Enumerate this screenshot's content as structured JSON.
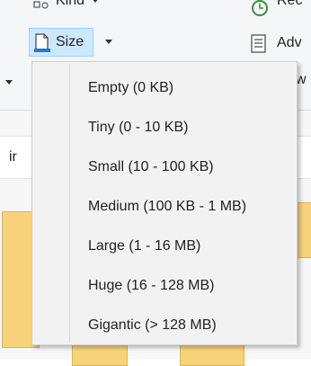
{
  "ribbon": {
    "kind_label": "Kind",
    "size_label": "Size",
    "recent_fragment": "Rec",
    "advanced_fragment": "Adv",
    "w_fragment": "w"
  },
  "header": {
    "fragment": "ir"
  },
  "size_menu": {
    "items": [
      {
        "label": "Empty (0 KB)"
      },
      {
        "label": "Tiny (0 - 10 KB)"
      },
      {
        "label": "Small (10 - 100 KB)"
      },
      {
        "label": "Medium (100 KB - 1 MB)"
      },
      {
        "label": "Large (1 - 16 MB)"
      },
      {
        "label": "Huge (16 - 128 MB)"
      },
      {
        "label": "Gigantic (> 128 MB)"
      }
    ]
  },
  "colors": {
    "hover_bg": "#cce8ff",
    "hover_border": "#99d1ff",
    "menu_bg": "#f2f2f2"
  }
}
